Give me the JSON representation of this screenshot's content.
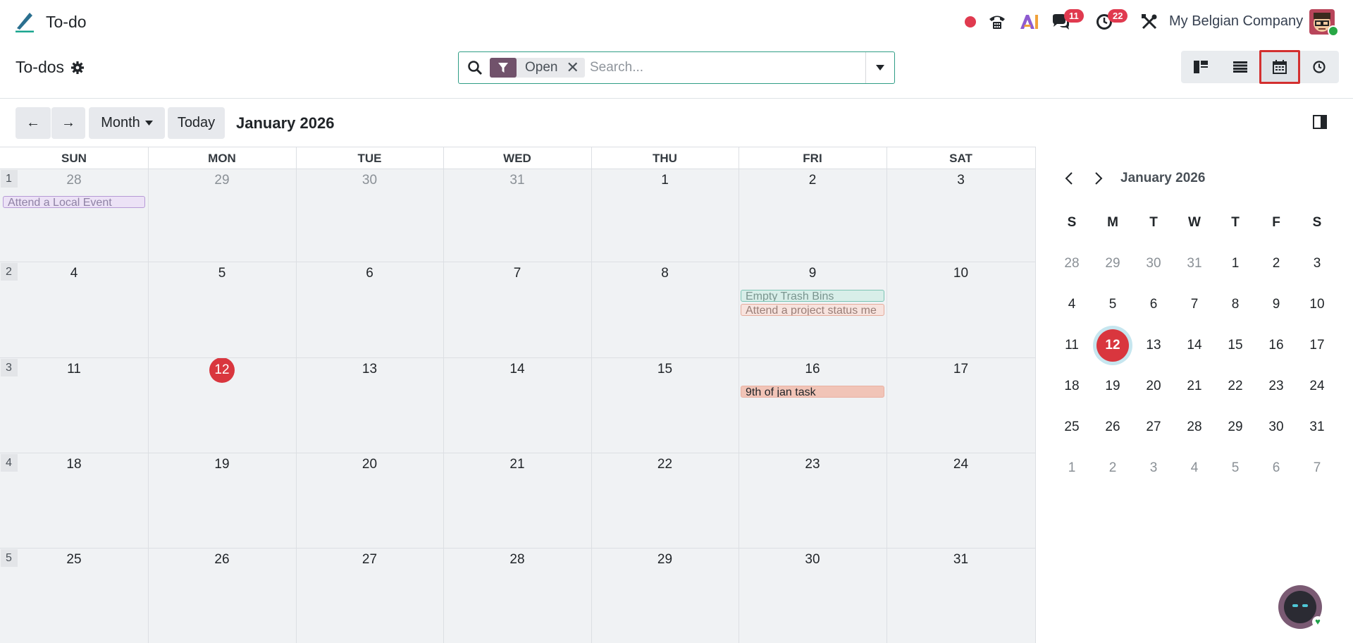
{
  "navbar": {
    "app_name": "To-do",
    "company": "My Belgian Company",
    "messages_badge": "11",
    "activities_badge": "22",
    "icons": [
      "record-dot-icon",
      "phone-icon",
      "ai-icon",
      "chat-icon",
      "clock-icon",
      "tools-icon"
    ]
  },
  "control_panel": {
    "title": "To-dos",
    "facet_label": "Open",
    "facet_remove": "✕",
    "search_placeholder": "Search..."
  },
  "views": [
    "kanban-view-icon",
    "list-view-icon",
    "calendar-view-icon",
    "activity-view-icon"
  ],
  "toolbar": {
    "prev": "←",
    "next": "→",
    "scale_label": "Month",
    "today_label": "Today",
    "period_title": "January 2026"
  },
  "calendar": {
    "day_headers": [
      "SUN",
      "MON",
      "TUE",
      "WED",
      "THU",
      "FRI",
      "SAT"
    ],
    "weeks": [
      {
        "num": "1",
        "days": [
          "28",
          "29",
          "30",
          "31",
          "1",
          "2",
          "3"
        ]
      },
      {
        "num": "2",
        "days": [
          "4",
          "5",
          "6",
          "7",
          "8",
          "9",
          "10"
        ]
      },
      {
        "num": "3",
        "days": [
          "11",
          "12",
          "13",
          "14",
          "15",
          "16",
          "17"
        ]
      },
      {
        "num": "4",
        "days": [
          "18",
          "19",
          "20",
          "21",
          "22",
          "23",
          "24"
        ]
      },
      {
        "num": "5",
        "days": [
          "25",
          "26",
          "27",
          "28",
          "29",
          "30",
          "31"
        ]
      }
    ],
    "today_label": "12",
    "events": {
      "e1": "Attend a Local Event",
      "e2": "Empty Trash Bins",
      "e3": "Attend a project status me",
      "e4": "9th of jan task"
    }
  },
  "mini_calendar": {
    "title": "January 2026",
    "headers": [
      "S",
      "M",
      "T",
      "W",
      "T",
      "F",
      "S"
    ],
    "rows": [
      [
        "28",
        "29",
        "30",
        "31",
        "1",
        "2",
        "3"
      ],
      [
        "4",
        "5",
        "6",
        "7",
        "8",
        "9",
        "10"
      ],
      [
        "11",
        "12",
        "13",
        "14",
        "15",
        "16",
        "17"
      ],
      [
        "18",
        "19",
        "20",
        "21",
        "22",
        "23",
        "24"
      ],
      [
        "25",
        "26",
        "27",
        "28",
        "29",
        "30",
        "31"
      ],
      [
        "1",
        "2",
        "3",
        "4",
        "5",
        "6",
        "7"
      ]
    ]
  },
  "colors": {
    "brand": "#71526b",
    "today": "#d9363e",
    "accent": "#2f9e86"
  }
}
